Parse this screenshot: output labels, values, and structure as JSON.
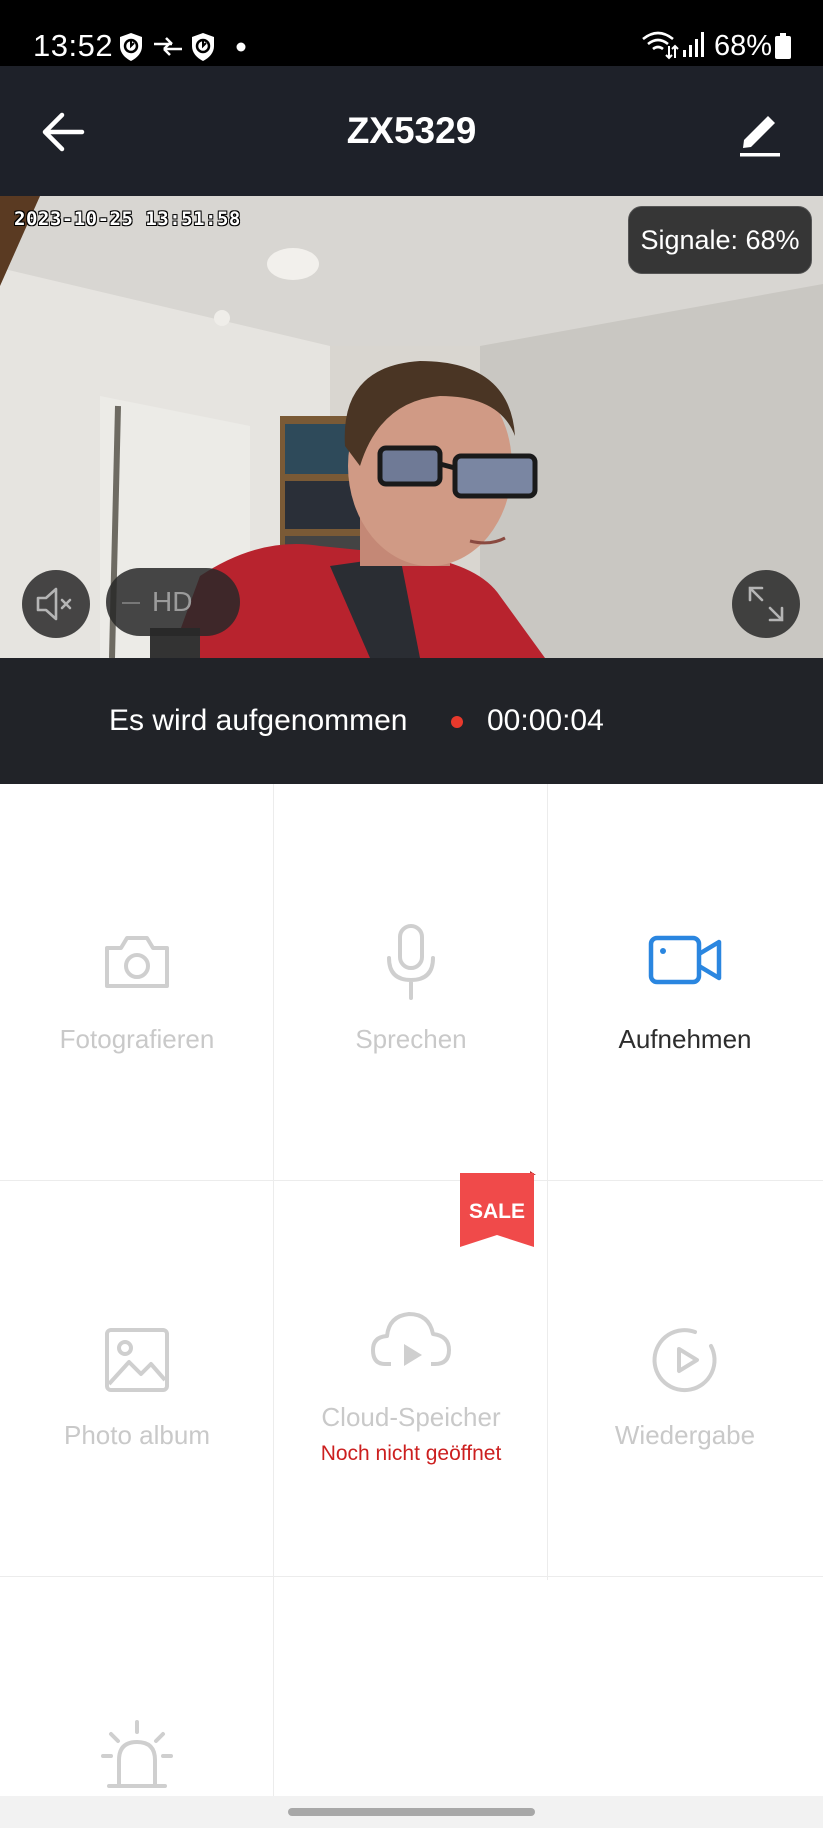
{
  "status_bar": {
    "time": "13:52",
    "battery": "68%",
    "icons": [
      "shield-check-icon",
      "data-transfer-icon",
      "shield-check-icon",
      "dot-icon",
      "wifi-icon",
      "cell-signal-icon",
      "battery-icon"
    ]
  },
  "header": {
    "title": "ZX5329",
    "back_icon": "arrow-left-icon",
    "edit_icon": "pencil-icon"
  },
  "video": {
    "timestamp": "2023-10-25 13:51:58",
    "signal_label": "Signale: 68%",
    "quality_label": "HD",
    "mute_icon": "speaker-muted-icon",
    "fullscreen_icon": "expand-icon"
  },
  "recording": {
    "label": "Es wird aufgenommen",
    "elapsed": "00:00:04",
    "indicator_color": "#e8392c"
  },
  "grid": {
    "items": [
      {
        "label": "Fotografieren",
        "icon": "camera-icon",
        "active": false
      },
      {
        "label": "Sprechen",
        "icon": "microphone-icon",
        "active": false
      },
      {
        "label": "Aufnehmen",
        "icon": "video-camera-icon",
        "active": true
      },
      {
        "label": "Photo album",
        "icon": "image-icon",
        "active": false
      },
      {
        "label": "Cloud-Speicher",
        "sublabel": "Noch nicht geöffnet",
        "icon": "cloud-play-icon",
        "badge": "SALE",
        "active": false
      },
      {
        "label": "Wiedergabe",
        "icon": "play-circle-icon",
        "active": false
      },
      {
        "label": "",
        "icon": "siren-icon",
        "active": false
      }
    ]
  },
  "colors": {
    "header_bg": "#1e2129",
    "accent_blue": "#2a86e0",
    "sale_red": "#f04a4a",
    "warning_red": "#cc1f1f"
  }
}
